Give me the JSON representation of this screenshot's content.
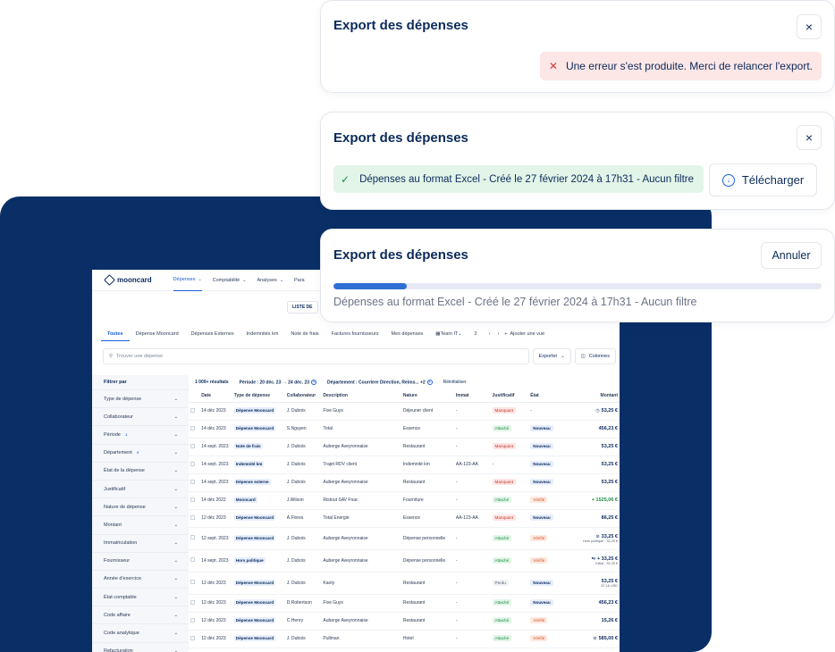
{
  "cards": {
    "error": {
      "title": "Export des dépenses",
      "close": "×",
      "icon": "x-icon",
      "message": "Une erreur s'est produite. Merci de relancer l'export."
    },
    "success": {
      "title": "Export des dépenses",
      "close": "×",
      "icon": "check-icon",
      "message": "Dépenses au format Excel - Créé le 27 février 2024 à 17h31 - Aucun filtre",
      "download_label": "Télécharger"
    },
    "progress": {
      "title": "Export des dépenses",
      "cancel_label": "Annuler",
      "message": "Dépenses au format Excel - Créé le 27 février 2024 à 17h31 - Aucun filtre",
      "progress_fraction": 0.15
    }
  },
  "app": {
    "logo": "mooncard",
    "nav": [
      {
        "label": "Dépenses",
        "active": true
      },
      {
        "label": "Comptabilité",
        "active": false
      },
      {
        "label": "Analyses",
        "active": false
      },
      {
        "label": "Para",
        "active": false
      }
    ],
    "list_button": "LISTE DE",
    "tabs": [
      "Toutes",
      "Dépense Mooncard",
      "Dépenses Externes",
      "Indemnités km",
      "Note de frais",
      "Factures fournisseurs",
      "Mes dépenses",
      "Team IT",
      "2"
    ],
    "add_view": "Ajouter une vue",
    "search_placeholder": "Trouver une dépense",
    "export_label": "Exporter",
    "columns_label": "Colonnes",
    "sidebar": {
      "title": "Filtrer par",
      "items": [
        {
          "label": "Type de dépense",
          "count": ""
        },
        {
          "label": "Collaborateur",
          "count": ""
        },
        {
          "label": "Période",
          "count": "1"
        },
        {
          "label": "Département",
          "count": "4"
        },
        {
          "label": "État de la dépense",
          "count": ""
        },
        {
          "label": "Justificatif",
          "count": ""
        },
        {
          "label": "Nature de dépense",
          "count": ""
        },
        {
          "label": "Montant",
          "count": ""
        },
        {
          "label": "Immatriculation",
          "count": ""
        },
        {
          "label": "Fournisseur",
          "count": ""
        },
        {
          "label": "Année d'exercice",
          "count": ""
        },
        {
          "label": "État comptable",
          "count": ""
        },
        {
          "label": "Code affaire",
          "count": ""
        },
        {
          "label": "Code analytique",
          "count": ""
        },
        {
          "label": "Refacturation",
          "count": ""
        }
      ]
    },
    "filters": {
      "results": "1 000+ résultats",
      "period": "Période : 20 déc. 23 → 24 déc. 23",
      "department": "Département : Courriere Direction, Reims... +2",
      "reset": "Réinitialiser"
    },
    "columns": [
      "Date",
      "Type de dépense",
      "Collaborateur",
      "Description",
      "Nature",
      "Immat",
      "Justificatif",
      "État",
      "Montant"
    ],
    "rows": [
      {
        "date": "14 déc 2023",
        "type": "Dépense Mooncard",
        "user": "J. Dubois",
        "desc": "Five Guys",
        "nature": "Déjeuner client",
        "immat": "-",
        "just": "Manquant",
        "just_style": "red",
        "etat": "-",
        "etat_style": "none",
        "amount": "53,25 €",
        "amount_icon": "clock",
        "sub": "",
        "green": false,
        "tall": false
      },
      {
        "date": "14 déc 2023",
        "type": "Dépense Mooncard",
        "user": "S.Nguyen",
        "desc": "Total",
        "nature": "Essence",
        "immat": "-",
        "just": "Attaché",
        "just_style": "green",
        "etat": "Nouveau",
        "etat_style": "blue",
        "amount": "456,23 €",
        "amount_icon": "",
        "sub": "",
        "green": false,
        "tall": false
      },
      {
        "date": "14 sept. 2023",
        "type": "Note de frais",
        "user": "J. Dubois",
        "desc": "Auberge Aveyronnaise",
        "nature": "Restaurant",
        "immat": "-",
        "just": "Manquant",
        "just_style": "red",
        "etat": "Nouveau",
        "etat_style": "blue",
        "amount": "53,25 €",
        "amount_icon": "",
        "sub": "",
        "green": false,
        "tall": false
      },
      {
        "date": "14 sept. 2023",
        "type": "Indemnité km",
        "user": "J. Dubois",
        "desc": "Trajet RDV client",
        "nature": "Indemnité km",
        "immat": "AA-123-AA",
        "just": "-",
        "just_style": "none",
        "etat": "Nouveau",
        "etat_style": "blue",
        "amount": "53,25 €",
        "amount_icon": "",
        "sub": "",
        "green": false,
        "tall": false
      },
      {
        "date": "14 sept. 2023",
        "type": "Dépense externe",
        "user": "J. Dubois",
        "desc": "Auberge Aveyronnaise",
        "nature": "Restaurant",
        "immat": "-",
        "just": "Manquant",
        "just_style": "red",
        "etat": "Nouveau",
        "etat_style": "blue",
        "amount": "53,25 €",
        "amount_icon": "",
        "sub": "",
        "green": false,
        "tall": false
      },
      {
        "date": "14 déc 2022",
        "type": "Mooncard",
        "user": "J.Wilson",
        "desc": "Ristout SAV Fnac",
        "nature": "Fourniture",
        "immat": "-",
        "just": "Attaché",
        "just_style": "green",
        "etat": "Vérifié",
        "etat_style": "orange",
        "amount": "+ 1525,06 €",
        "amount_icon": "",
        "sub": "",
        "green": true,
        "tall": false
      },
      {
        "date": "12 déc 2023",
        "type": "Dépense Mooncard",
        "user": "A.Flores",
        "desc": "Total Energie",
        "nature": "Essence",
        "immat": "AA-123-AA",
        "just": "Manquant",
        "just_style": "red",
        "etat": "Nouveau",
        "etat_style": "blue",
        "amount": "86,25 €",
        "amount_icon": "",
        "sub": "",
        "green": false,
        "tall": false
      },
      {
        "date": "12 sept. 2023",
        "type": "Dépense Mooncard",
        "user": "J. Dubois",
        "desc": "Auberge Aveyronnaise",
        "nature": "Dépense personnelle",
        "immat": "-",
        "just": "Attaché",
        "just_style": "green",
        "etat": "Vérifié",
        "etat_style": "orange",
        "amount": "33,25 €",
        "amount_icon": "alert",
        "sub": "Hors politique : 33,25 €",
        "green": false,
        "tall": true
      },
      {
        "date": "14 sept. 2023",
        "type": "Hors politique",
        "user": "J. Dubois",
        "desc": "Auberge Aveyronnaise",
        "nature": "Dépense personnelle",
        "immat": "-",
        "just": "Attaché",
        "just_style": "green",
        "etat": "Vérifié",
        "etat_style": "orange",
        "amount": "+ 33,25 €",
        "amount_icon": "swap",
        "sub": "Initial : 33,25 €",
        "green": false,
        "tall": true
      },
      {
        "date": "12 déc 2023",
        "type": "Dépense Mooncard",
        "user": "J. Dubois",
        "desc": "Kaoty",
        "nature": "Restaurant",
        "immat": "-",
        "just": "Perdu",
        "just_style": "gray",
        "etat": "Nouveau",
        "etat_style": "blue",
        "amount": "53,25 €",
        "amount_icon": "",
        "sub": "57,16 USD",
        "green": false,
        "tall": true
      },
      {
        "date": "12 déc 2023",
        "type": "Dépense Mooncard",
        "user": "D.Robertson",
        "desc": "Five Guys",
        "nature": "Restaurant",
        "immat": "-",
        "just": "Attaché",
        "just_style": "green",
        "etat": "Nouveau",
        "etat_style": "blue",
        "amount": "456,23 €",
        "amount_icon": "",
        "sub": "",
        "green": false,
        "tall": false
      },
      {
        "date": "12 déc 2023",
        "type": "Dépense Mooncard",
        "user": "C.Henry",
        "desc": "Auberge Aveyronnaise",
        "nature": "Restaurant",
        "immat": "-",
        "just": "Attaché",
        "just_style": "green",
        "etat": "Vérifié",
        "etat_style": "orange",
        "amount": "15,26 €",
        "amount_icon": "",
        "sub": "",
        "green": false,
        "tall": false
      },
      {
        "date": "12 déc 2023",
        "type": "Dépense Mooncard",
        "user": "J. Dubois",
        "desc": "Pullman",
        "nature": "Hotel",
        "immat": "-",
        "just": "Attaché",
        "just_style": "green",
        "etat": "Vérifié",
        "etat_style": "orange",
        "amount": "585,00 €",
        "amount_icon": "alert",
        "sub": "",
        "green": false,
        "tall": false
      }
    ]
  },
  "colors": {
    "navy": "#0a2f66",
    "accent": "#1a5fd6",
    "error_bg": "#fde6e6",
    "success_bg": "#e3f5e8",
    "progress": "#2f6fd6"
  }
}
